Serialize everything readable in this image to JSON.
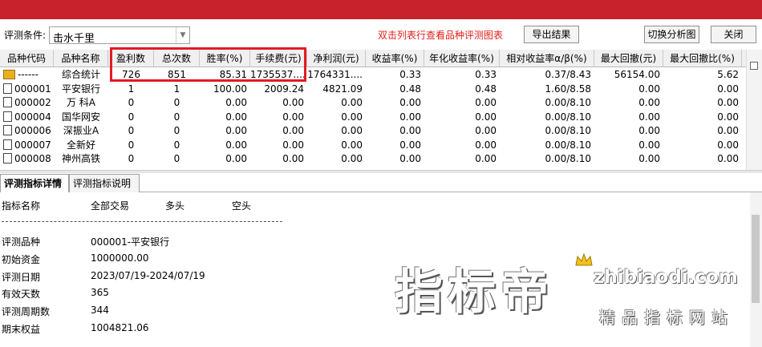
{
  "toolbar": {
    "condition_label": "评测条件:",
    "condition_value": "击水千里",
    "hint": "双击列表行查看品种评测图表",
    "export_label": "导出结果",
    "switch_label": "切换分析图",
    "close_label": "关闭"
  },
  "table": {
    "columns": [
      "品种代码",
      "品种名称",
      "盈利数",
      "总次数",
      "胜率(%)",
      "手续费(元)",
      "净利润(元)",
      "收益率(%)",
      "年化收益率(%)",
      "相对收益率α/β(%)",
      "最大回撤(元)",
      "最大回撤比(%)"
    ],
    "rows": [
      {
        "code": "------",
        "name": "综合统计",
        "win": "726",
        "total": "851",
        "rate": "85.31",
        "fee": "1735537....",
        "net": "1764331....",
        "ret": "0.33",
        "annual": "0.33",
        "rel": "0.37/8.43",
        "dd": "56154.00",
        "ddr": "5.62",
        "icon": "folder-icon"
      },
      {
        "code": "000001",
        "name": "平安银行",
        "win": "1",
        "total": "1",
        "rate": "100.00",
        "fee": "2009.24",
        "net": "4821.09",
        "ret": "0.48",
        "annual": "0.48",
        "rel": "1.60/8.58",
        "dd": "0.00",
        "ddr": "0.00",
        "icon": "document-icon"
      },
      {
        "code": "000002",
        "name": "万 科A",
        "win": "0",
        "total": "0",
        "rate": "0.00",
        "fee": "0.00",
        "net": "0.00",
        "ret": "0.00",
        "annual": "0.00",
        "rel": "0.00/8.10",
        "dd": "0.00",
        "ddr": "0.00",
        "icon": "document-icon"
      },
      {
        "code": "000004",
        "name": "国华网安",
        "win": "0",
        "total": "0",
        "rate": "0.00",
        "fee": "0.00",
        "net": "0.00",
        "ret": "0.00",
        "annual": "0.00",
        "rel": "0.00/8.10",
        "dd": "0.00",
        "ddr": "0.00",
        "icon": "document-icon"
      },
      {
        "code": "000006",
        "name": "深振业A",
        "win": "0",
        "total": "0",
        "rate": "0.00",
        "fee": "0.00",
        "net": "0.00",
        "ret": "0.00",
        "annual": "0.00",
        "rel": "0.00/8.10",
        "dd": "0.00",
        "ddr": "0.00",
        "icon": "document-icon"
      },
      {
        "code": "000007",
        "name": "全新好",
        "win": "0",
        "total": "0",
        "rate": "0.00",
        "fee": "0.00",
        "net": "0.00",
        "ret": "0.00",
        "annual": "0.00",
        "rel": "0.00/8.10",
        "dd": "0.00",
        "ddr": "0.00",
        "icon": "document-icon"
      },
      {
        "code": "000008",
        "name": "神州高铁",
        "win": "0",
        "total": "0",
        "rate": "0.00",
        "fee": "0.00",
        "net": "0.00",
        "ret": "0.00",
        "annual": "0.00",
        "rel": "0.00/8.10",
        "dd": "0.00",
        "ddr": "0.00",
        "icon": "document-icon"
      }
    ]
  },
  "tabs": [
    "评测指标详情",
    "评测指标说明"
  ],
  "detail": {
    "header": [
      "指标名称",
      "全部交易",
      "多头",
      "空头"
    ],
    "items": [
      {
        "label": "评测品种",
        "value": "000001-平安银行"
      },
      {
        "label": "初始资金",
        "value": "1000000.00"
      },
      {
        "label": "评测日期",
        "value": "2023/07/19-2024/07/19"
      },
      {
        "label": "有效天数",
        "value": "365"
      },
      {
        "label": "评测周期数",
        "value": " 344"
      },
      {
        "label": "期末权益",
        "value": "1004821.06"
      }
    ]
  },
  "watermark": {
    "big": "指标帝",
    "url": "zhibiaodi.com",
    "sub": "精品指标网站"
  },
  "colors": {
    "titlebar": "#c8232c",
    "hint": "#e0201b",
    "highlight": "#e31b23"
  }
}
